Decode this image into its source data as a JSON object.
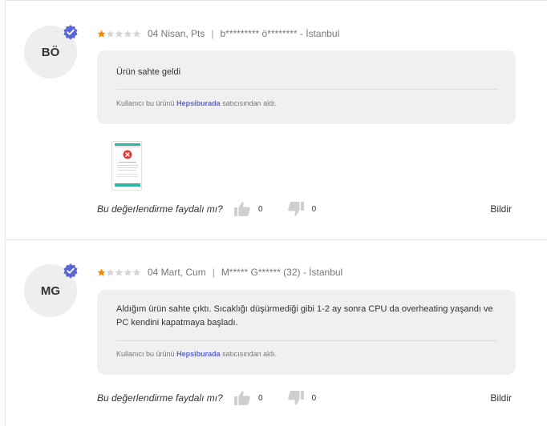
{
  "reviews": [
    {
      "initials": "BÖ",
      "rating": 1,
      "max_rating": 5,
      "date": "04 Nisan, Pts",
      "author": "b********* ö******** - İstanbul",
      "text": "Ürün sahte geldi",
      "seller_prefix": "Kullanıcı bu ürünü",
      "seller_name": "Hepsiburada",
      "seller_suffix": "satıcısından aldı.",
      "has_photo": true,
      "helpful_question": "Bu değerlendirme faydalı mı?",
      "likes": "0",
      "dislikes": "0",
      "report_label": "Bildir"
    },
    {
      "initials": "MG",
      "rating": 1,
      "max_rating": 5,
      "date": "04 Mart, Cum",
      "author": "M***** G****** (32) - İstanbul",
      "text": "Aldığım ürün sahte çıktı. Sıcaklığı düşürmediği gibi 1-2 ay sonra CPU da overheating yaşandı ve PC kendini kapatmaya başladı.",
      "seller_prefix": "Kullanıcı bu ürünü",
      "seller_name": "Hepsiburada",
      "seller_suffix": "satıcısından aldı.",
      "has_photo": false,
      "helpful_question": "Bu değerlendirme faydalı mı?",
      "likes": "0",
      "dislikes": "0",
      "report_label": "Bildir"
    }
  ],
  "colors": {
    "star_filled": "#f28b00",
    "star_empty": "#d6d6d6",
    "verified_badge": "#5b66d4",
    "brand": "#5b66d4",
    "thumb": "#cfcfcf"
  }
}
